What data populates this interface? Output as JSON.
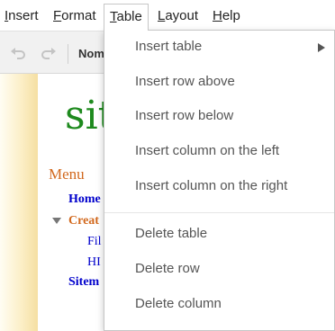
{
  "menubar": {
    "items": [
      {
        "pre": "",
        "key": "I",
        "post": "nsert"
      },
      {
        "pre": "",
        "key": "F",
        "post": "ormat"
      },
      {
        "pre": "",
        "key": "T",
        "post": "able"
      },
      {
        "pre": "",
        "key": "L",
        "post": "ayout"
      },
      {
        "pre": "",
        "key": "H",
        "post": "elp"
      }
    ],
    "active": "Table"
  },
  "toolbar": {
    "undo_icon": "undo-icon",
    "redo_icon": "redo-icon",
    "style_label": "Nom"
  },
  "page": {
    "site_title": "sit",
    "menu_heading": "Menu",
    "nav": {
      "home": "Home",
      "create": "Creat",
      "sub1": "Fil",
      "sub2": "HI",
      "sitemap": "Sitem"
    },
    "right_glyph": "e"
  },
  "table_menu": {
    "items": [
      {
        "label": "Insert table",
        "has_submenu": true
      },
      {
        "label": "Insert row above"
      },
      {
        "label": "Insert row below"
      },
      {
        "label": "Insert column on the left"
      },
      {
        "label": "Insert column on the right"
      },
      {
        "label": "Delete table"
      },
      {
        "label": "Delete row"
      },
      {
        "label": "Delete column"
      }
    ]
  },
  "colors": {
    "site_title": "#1e8a1e",
    "link": "#0000cc",
    "accent_orange": "#d2691e",
    "menu_text": "#555555"
  }
}
